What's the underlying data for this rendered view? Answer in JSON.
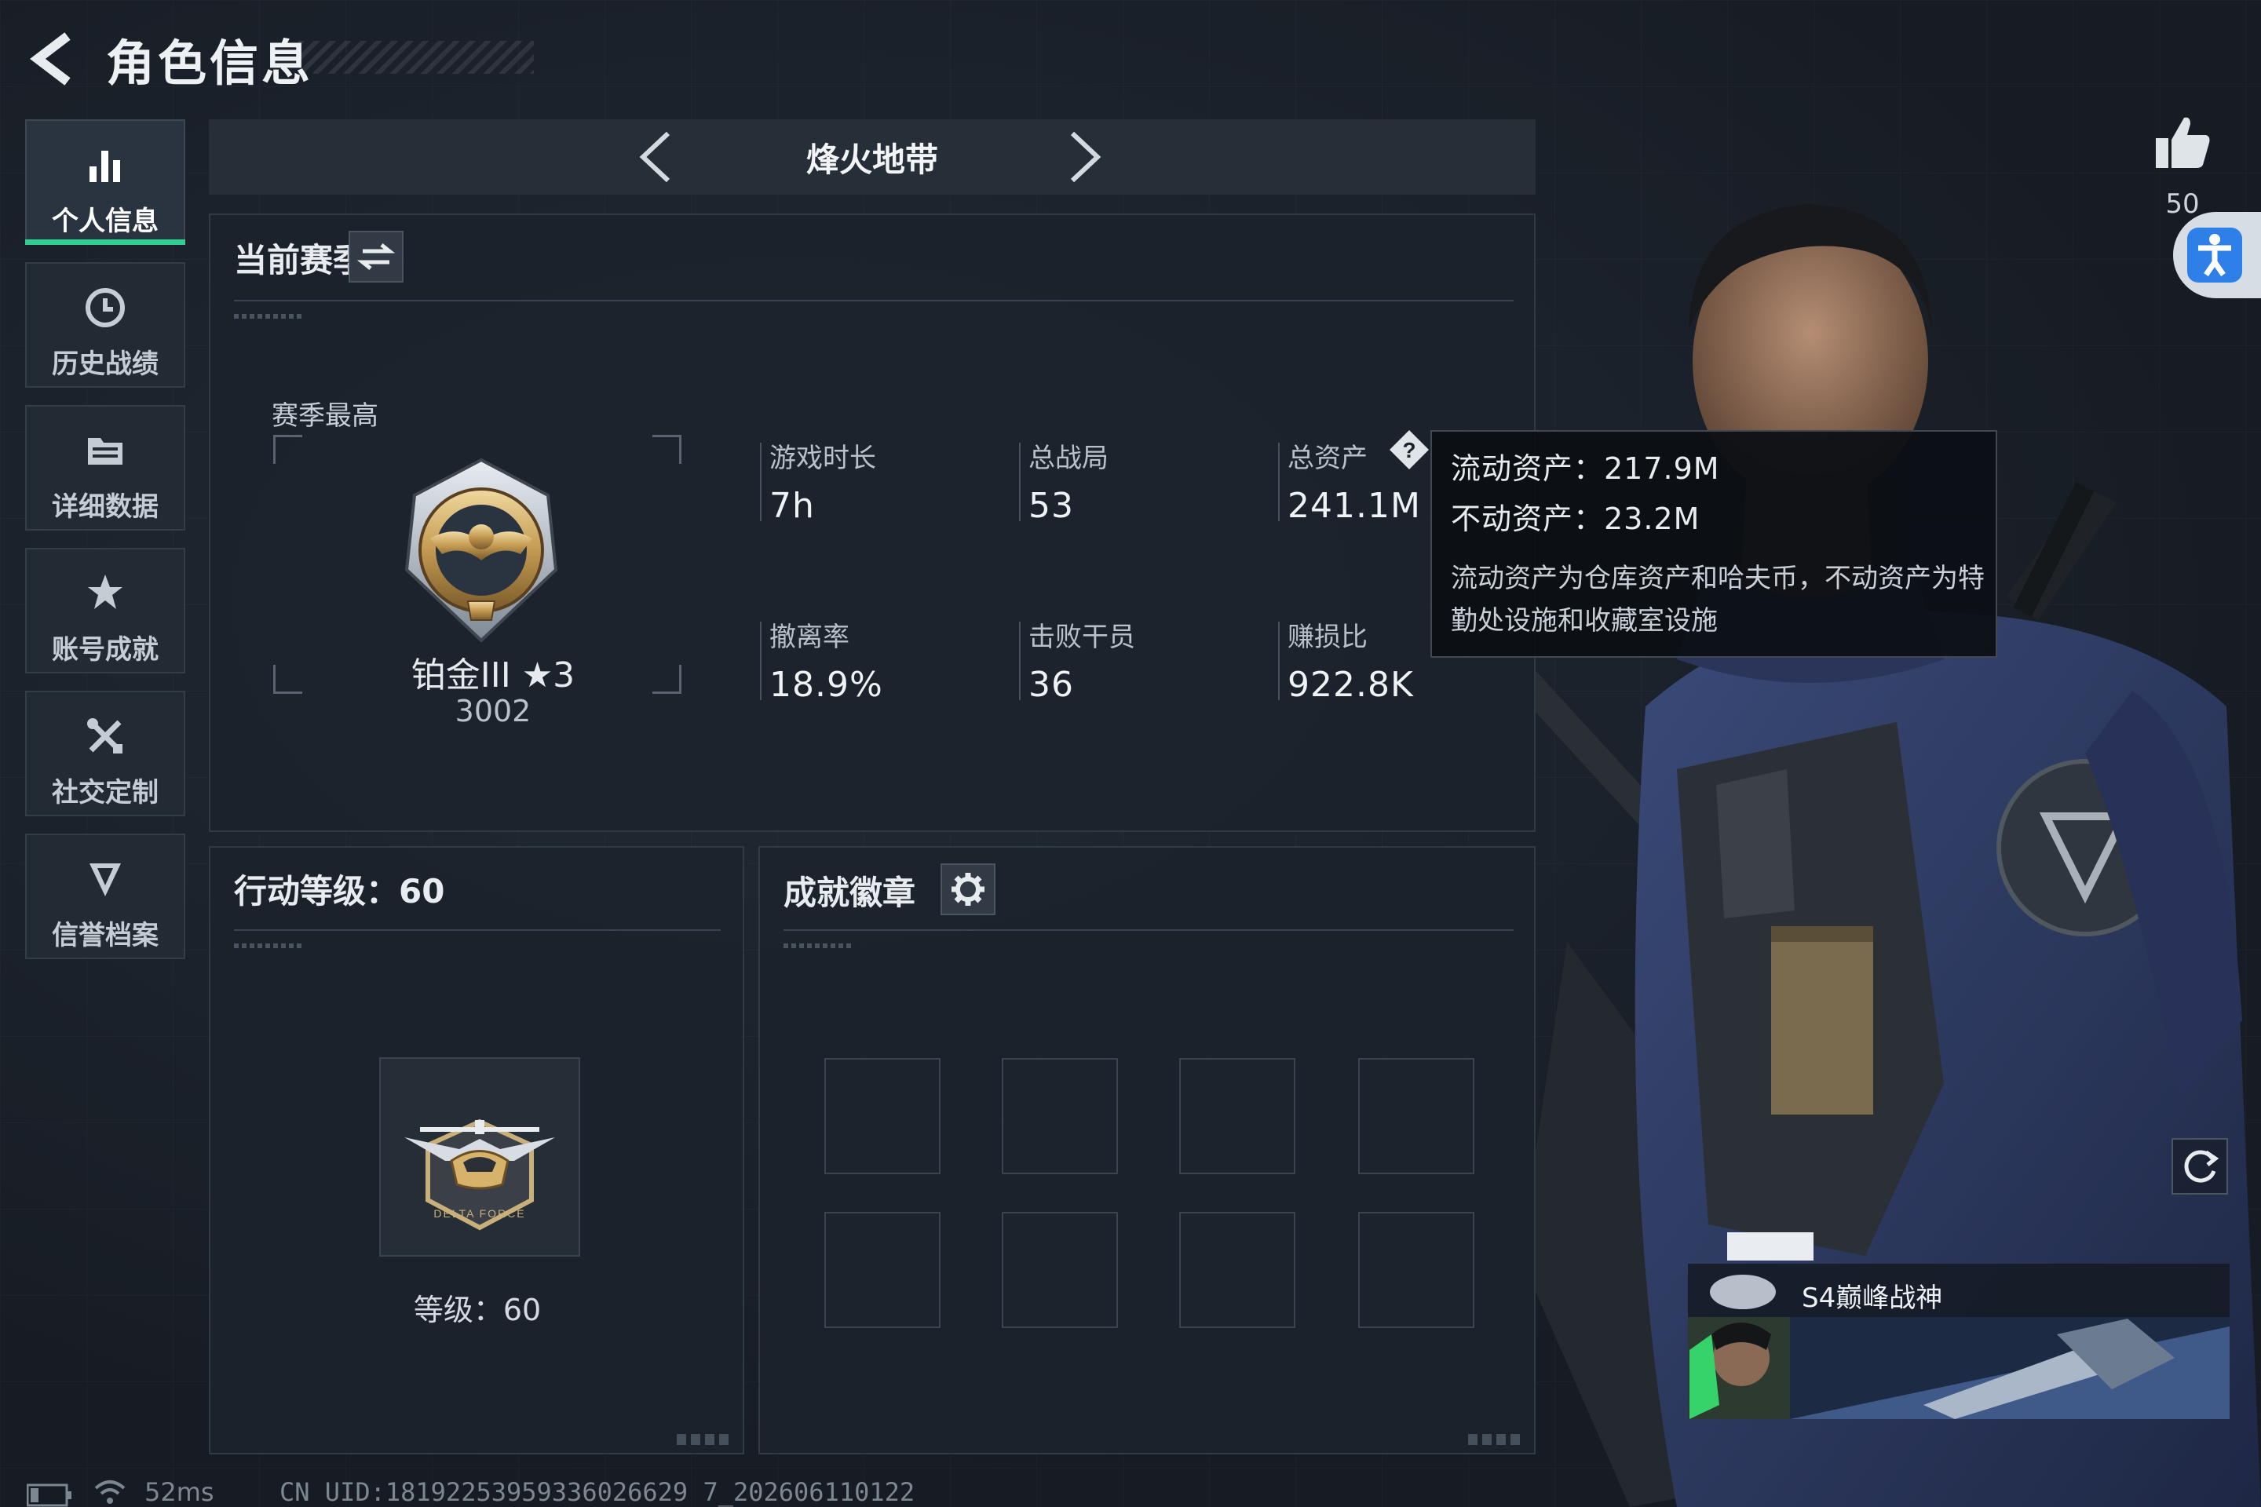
{
  "header": {
    "title": "角色信息"
  },
  "sidebar": {
    "items": [
      {
        "label": "个人信息",
        "icon": "bar-chart-icon",
        "active": true
      },
      {
        "label": "历史战绩",
        "icon": "history-clock-icon"
      },
      {
        "label": "详细数据",
        "icon": "folder-data-icon"
      },
      {
        "label": "账号成就",
        "icon": "achievement-star-icon"
      },
      {
        "label": "社交定制",
        "icon": "tools-cross-icon"
      },
      {
        "label": "信誉档案",
        "icon": "shield-emblem-icon"
      }
    ]
  },
  "mode": {
    "title": "烽火地带"
  },
  "season": {
    "header": "当前赛季",
    "best_label": "赛季最高",
    "rank_name": "铂金III ★3",
    "rank_score": "3002",
    "stats": [
      {
        "label": "游戏时长",
        "value": "7h"
      },
      {
        "label": "总战局",
        "value": "53"
      },
      {
        "label": "总资产",
        "value": "241.1M"
      },
      {
        "label": "撤离率",
        "value": "18.9%"
      },
      {
        "label": "击败干员",
        "value": "36"
      },
      {
        "label": "赚损比",
        "value": "922.8K"
      }
    ]
  },
  "tooltip": {
    "liquid": "流动资产：217.9M",
    "fixed": "不动资产：23.2M",
    "note": "流动资产为仓库资产和哈夫币，不动资产为特勤处设施和收藏室设施"
  },
  "action_level": {
    "header": "行动等级：60",
    "level_text": "等级：60"
  },
  "badges": {
    "header": "成就徽章"
  },
  "social": {
    "like_count": "50"
  },
  "honor": {
    "label": "S4巅峰战神"
  },
  "status": {
    "ping": "52ms",
    "uid": "CN UID:18192253959336026629 7_202606110122"
  },
  "colors": {
    "accent": "#2fcf91",
    "panel": "#1c232c",
    "access": "#2f7fe8"
  }
}
